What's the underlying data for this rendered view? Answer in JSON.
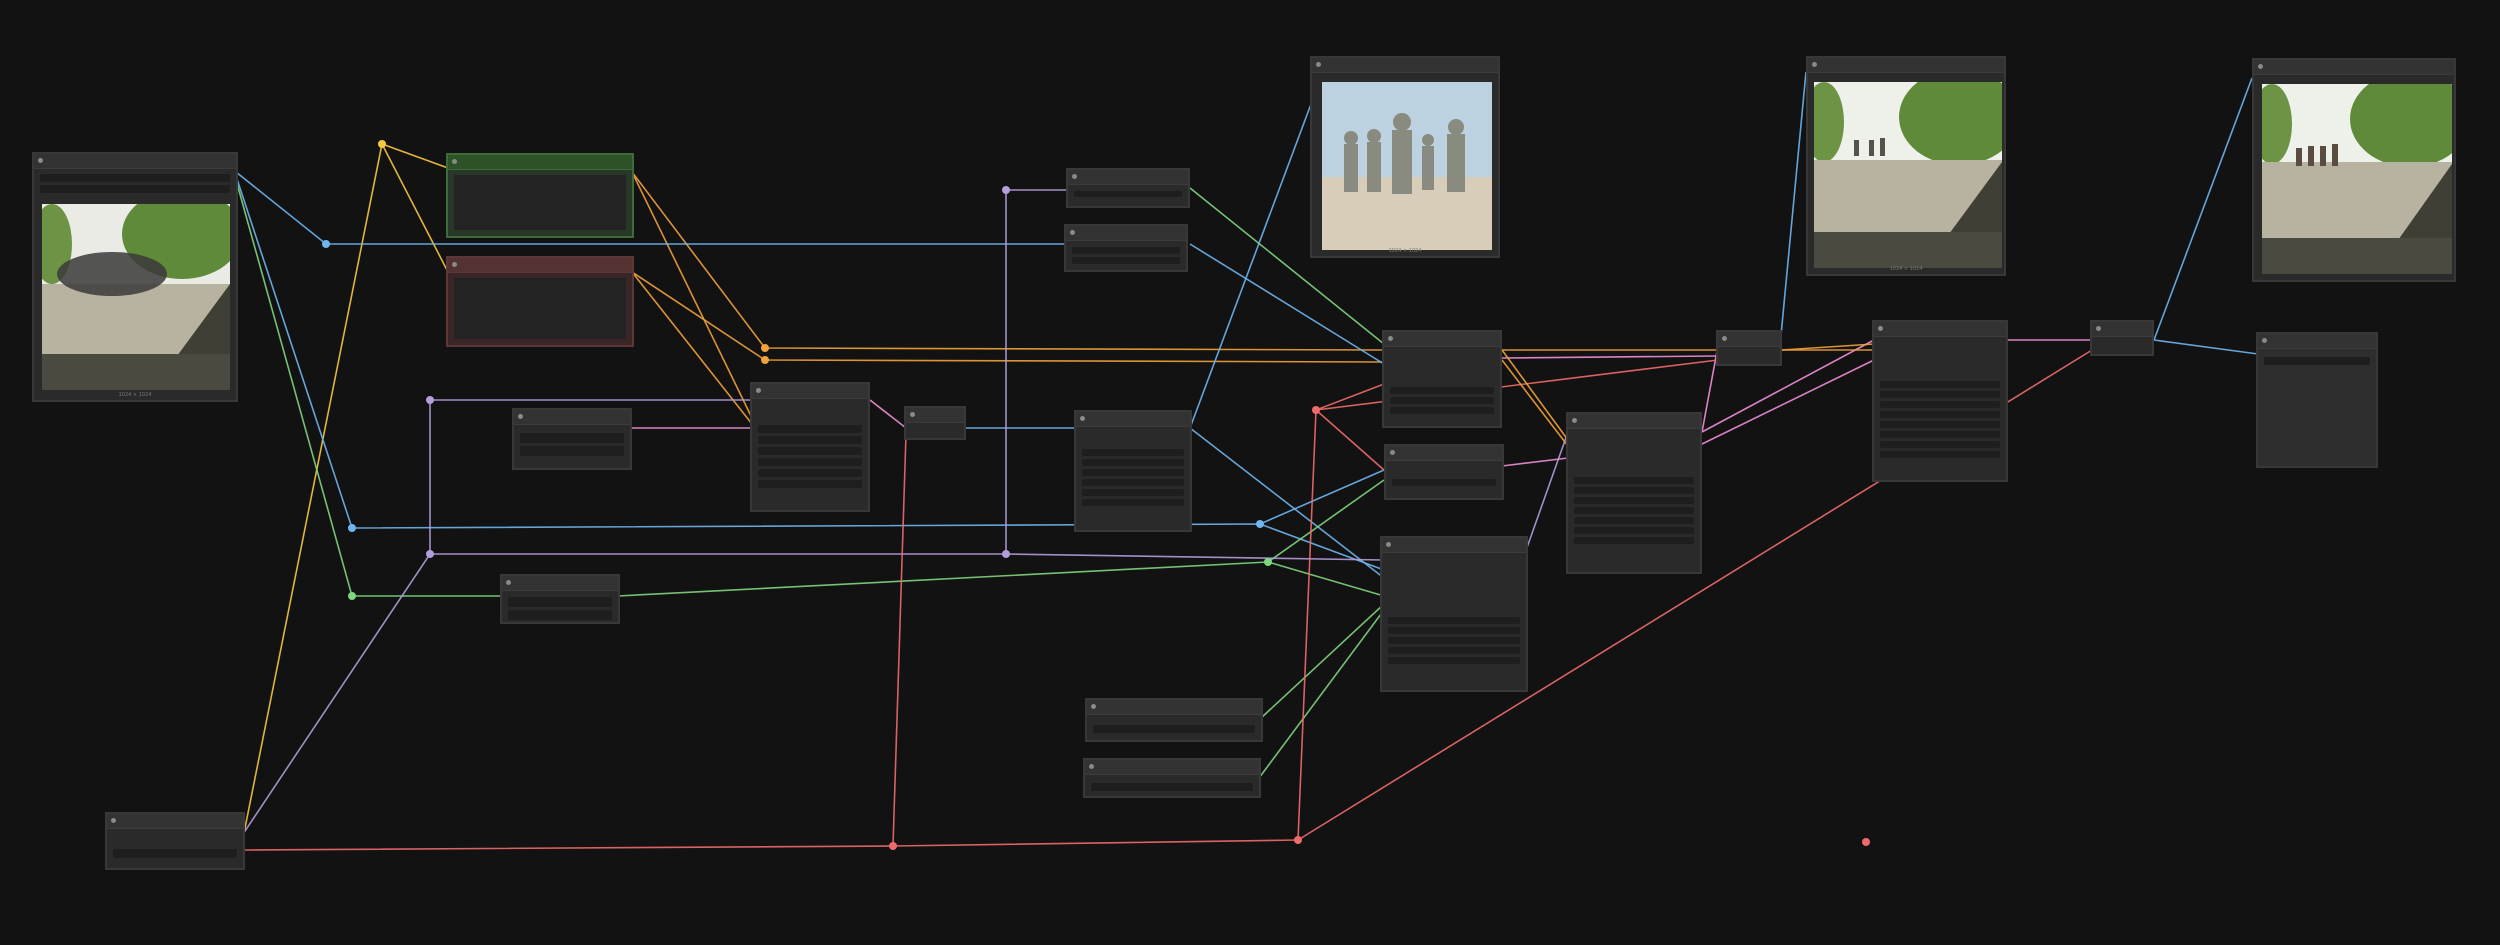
{
  "canvas": {
    "background": "#121212"
  },
  "colors": {
    "clip": "#f7c841",
    "model": "#b39ddb",
    "vae": "#ef6b6b",
    "image": "#6fb6f0",
    "latent": "#f08fd8",
    "conditioning": "#f2a23a",
    "mask": "#7fd67f"
  },
  "nodes": {
    "load_image": {
      "caption": "1024 × 1024"
    },
    "preview_center": {
      "caption": "1024 × 1024"
    },
    "preview_right1": {
      "caption": "1024 × 1024"
    },
    "preview_right2": {
      "caption": ""
    }
  },
  "icons": {
    "reroute": "reroute-dot-icon",
    "node_collapse": "node-collapse-dot-icon"
  }
}
